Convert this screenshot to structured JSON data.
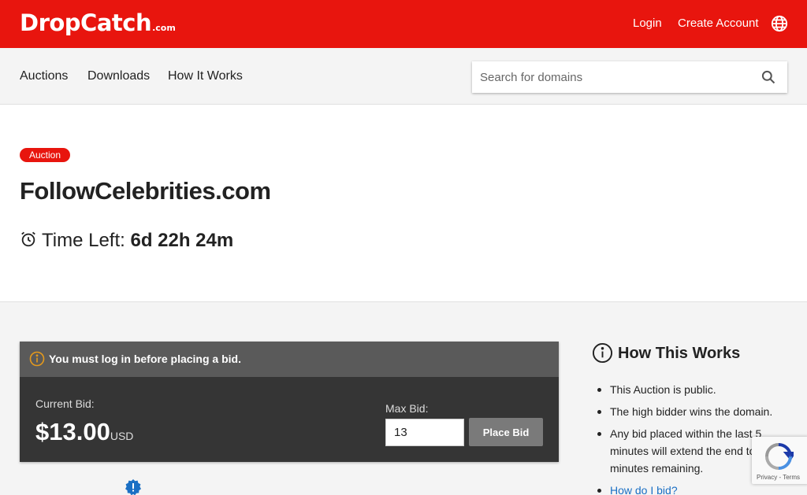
{
  "header": {
    "logo": "DropCatch",
    "logo_suffix": ".com",
    "login": "Login",
    "create_account": "Create Account"
  },
  "nav": {
    "items": [
      "Auctions",
      "Downloads",
      "How It Works"
    ],
    "search_placeholder": "Search for domains"
  },
  "auction": {
    "badge": "Auction",
    "domain": "FollowCelebrities.com",
    "time_left_label": "Time Left:",
    "time_left_value": "6d 22h 24m"
  },
  "bid": {
    "warning": "You must log in before placing a bid.",
    "current_bid_label": "Current Bid:",
    "current_bid_value": "$13.00",
    "currency": "USD",
    "max_bid_label": "Max Bid:",
    "max_bid_value": "13",
    "place_bid_label": "Place Bid"
  },
  "how_it_works": {
    "title": "How This Works",
    "items": [
      "This Auction is public.",
      "The high bidder wins the domain.",
      "Any bid placed within the last 5 minutes will extend the end to 5 minutes remaining."
    ],
    "link": "How do I bid?"
  },
  "recaptcha": {
    "privacy": "Privacy",
    "separator": " - ",
    "terms": "Terms"
  },
  "colors": {
    "brand_red": "#e8150e",
    "link_blue": "#1a6fc4",
    "bid_panel": "#353535"
  },
  "icons": [
    "globe-icon",
    "search-icon",
    "alarm-clock-icon",
    "info-circle-icon",
    "alert-badge-icon",
    "recaptcha-icon"
  ]
}
